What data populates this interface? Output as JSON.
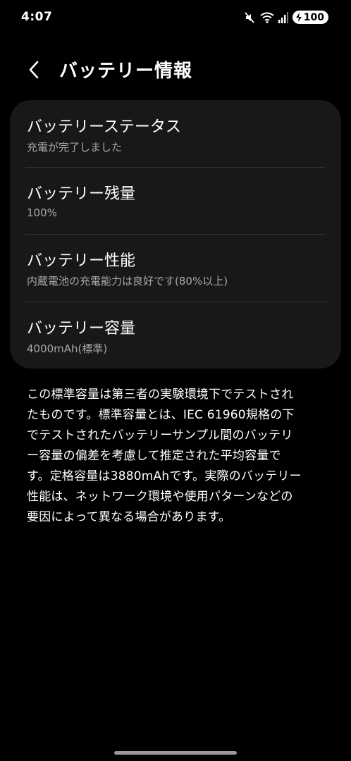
{
  "status_bar": {
    "time": "4:07",
    "battery_level": "100",
    "icons": [
      "mute-icon",
      "wifi-icon",
      "signal-icon",
      "battery-charging-icon"
    ]
  },
  "header": {
    "title": "バッテリー情報",
    "back_icon": "chevron-left-icon"
  },
  "items": [
    {
      "label": "バッテリーステータス",
      "value": "充電が完了しました"
    },
    {
      "label": "バッテリー残量",
      "value": "100%"
    },
    {
      "label": "バッテリー性能",
      "value": "内蔵電池の充電能力は良好です(80%以上)"
    },
    {
      "label": "バッテリー容量",
      "value": "4000mAh(標準)"
    }
  ],
  "description": {
    "lines": [
      "この標準容量は第三者の実験環境下でテストされ",
      "たものです。標準容量とは、IEC 61960規格の下",
      "でテストされたバッテリーサンプル間のバッテリ",
      "ー容量の偏差を考慮して推定された平均容量で",
      "す。定格容量は3880mAhです。実際のバッテリー",
      "性能は、ネットワーク環境や使用パターンなどの",
      "要因によって異なる場合があります。"
    ]
  },
  "colors": {
    "background": "#000000",
    "card": "#181818",
    "secondary_text": "#a8a8a8",
    "divider": "#333333"
  }
}
